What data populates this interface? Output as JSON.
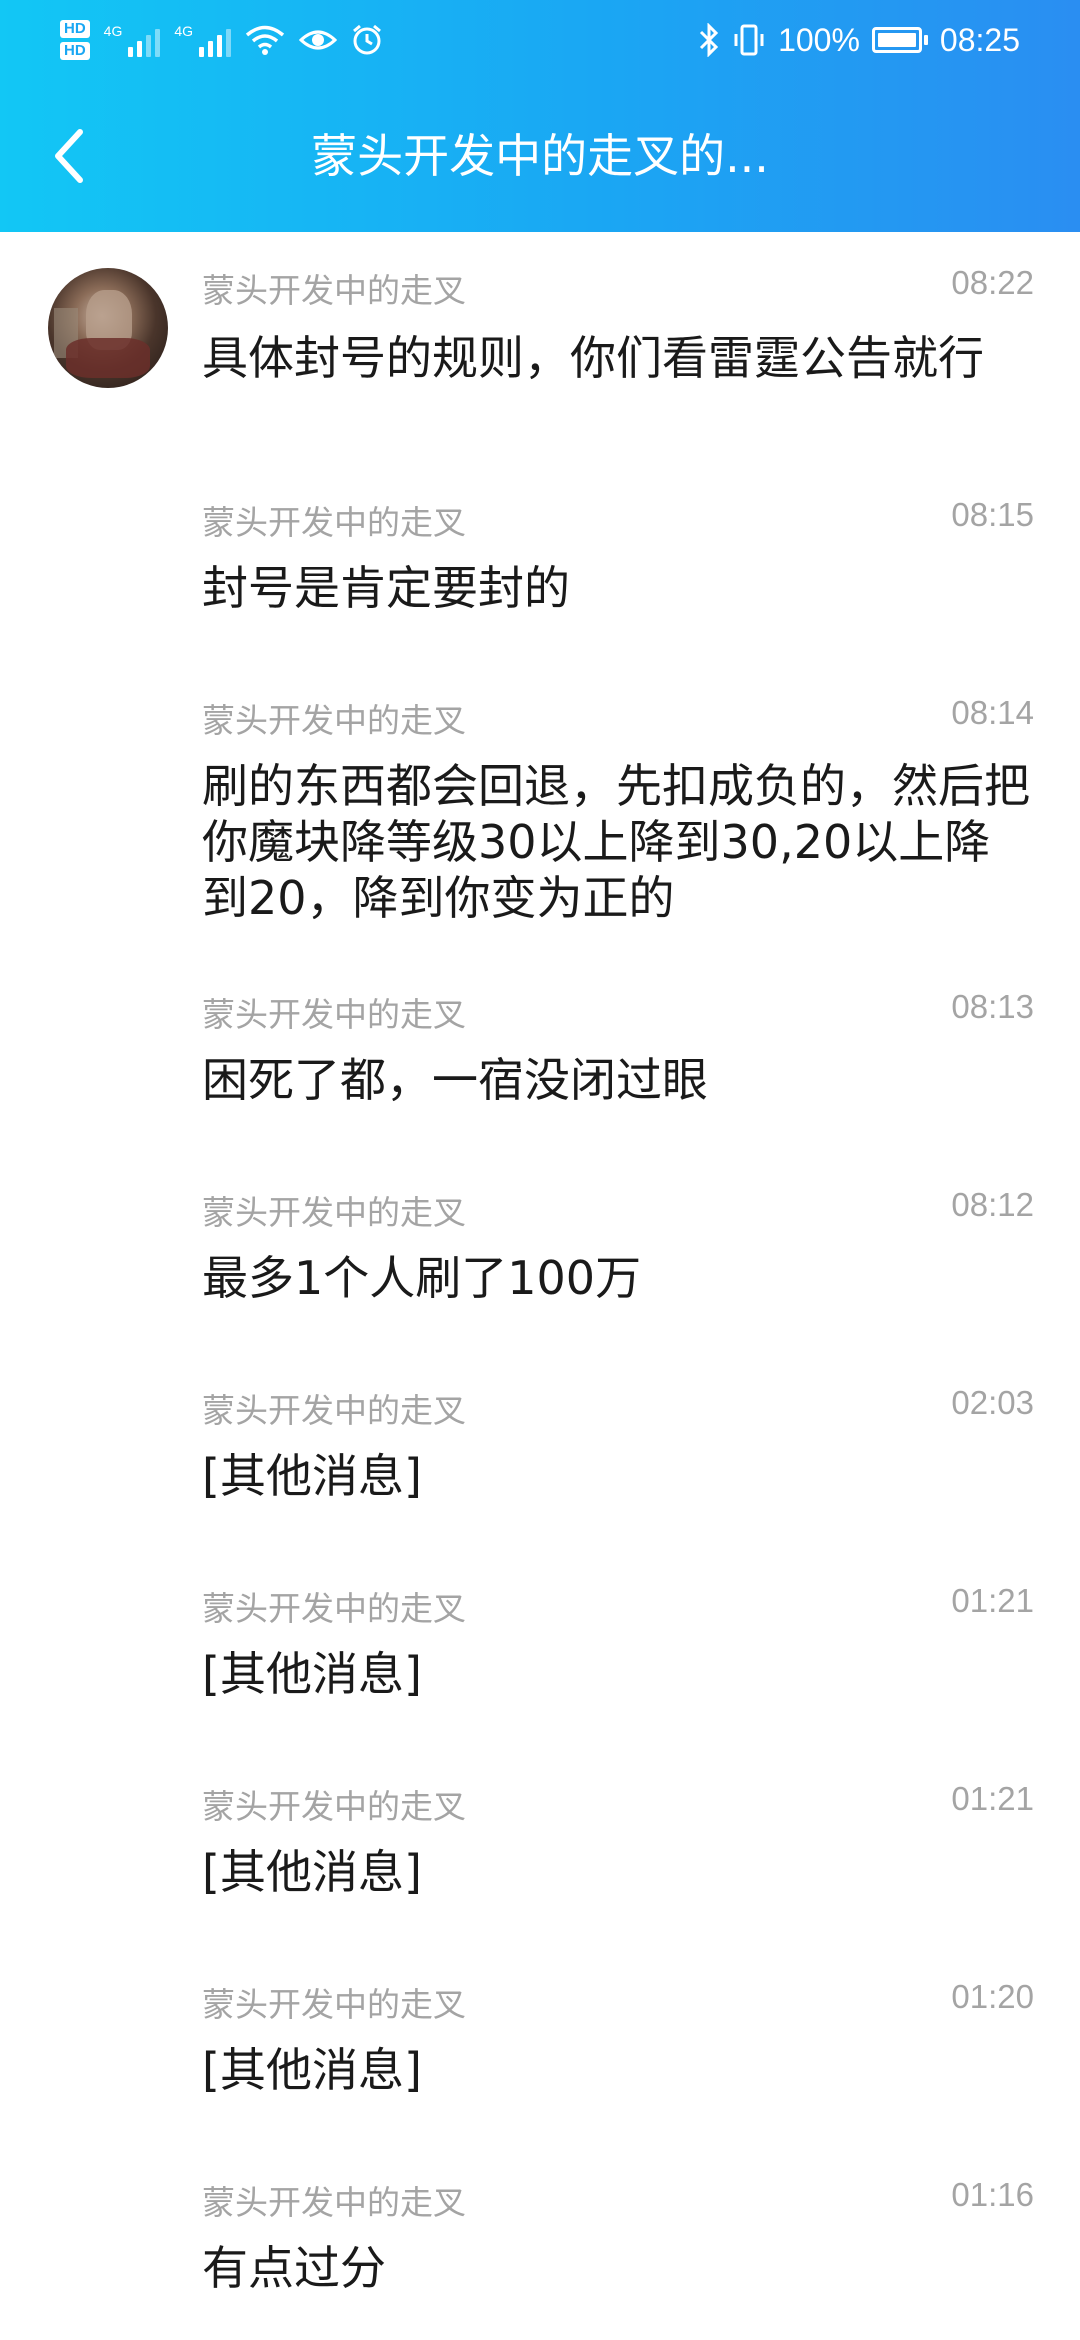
{
  "status_bar": {
    "left_icons": [
      "hd-1-icon",
      "hd-2-icon",
      "signal-4g-icon",
      "signal-4g-icon",
      "wifi-icon",
      "eye-icon",
      "alarm-icon"
    ],
    "hd1": "HD",
    "hd2": "HD",
    "network1": "4G",
    "network2": "4G",
    "right_icons": [
      "bluetooth-icon",
      "vibrate-icon",
      "battery-icon"
    ],
    "battery": "100%",
    "time": "08:25"
  },
  "header": {
    "back_icon": "chevron-left-icon",
    "title": "蒙头开发中的走叉的..."
  },
  "messages": [
    {
      "sender": "蒙头开发中的走叉",
      "time": "08:22",
      "text": "具体封号的规则，你们看雷霆公告就行"
    },
    {
      "sender": "蒙头开发中的走叉",
      "time": "08:15",
      "text": "封号是肯定要封的"
    },
    {
      "sender": "蒙头开发中的走叉",
      "time": "08:14",
      "text": "刷的东西都会回退，先扣成负的，然后把你魔块降等级30以上降到30,20以上降到20，降到你变为正的"
    },
    {
      "sender": "蒙头开发中的走叉",
      "time": "08:13",
      "text": "困死了都，一宿没闭过眼"
    },
    {
      "sender": "蒙头开发中的走叉",
      "time": "08:12",
      "text": "最多1个人刷了100万"
    },
    {
      "sender": "蒙头开发中的走叉",
      "time": "02:03",
      "text": "[其他消息]"
    },
    {
      "sender": "蒙头开发中的走叉",
      "time": "01:21",
      "text": "[其他消息]"
    },
    {
      "sender": "蒙头开发中的走叉",
      "time": "01:21",
      "text": "[其他消息]"
    },
    {
      "sender": "蒙头开发中的走叉",
      "time": "01:20",
      "text": "[其他消息]"
    },
    {
      "sender": "蒙头开发中的走叉",
      "time": "01:16",
      "text": "有点过分"
    }
  ]
}
